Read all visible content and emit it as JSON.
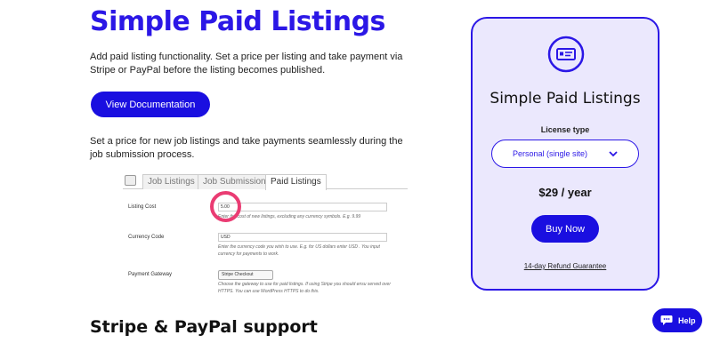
{
  "main": {
    "title": "Simple Paid Listings",
    "intro": "Add paid listing functionality. Set a price per listing and take payment via Stripe or PayPal before the listing becomes published.",
    "doc_button": "View Documentation",
    "description": "Set a price for new job listings and take payments seamlessly during the job submission process.",
    "section_title": "Stripe & PayPal support"
  },
  "screenshot": {
    "tabs": [
      "Job Listings",
      "Job Submission",
      "Paid Listings"
    ],
    "active_tab": "Paid Listings",
    "fields": [
      {
        "label": "Listing Cost",
        "value": "5.00",
        "help": "Enter the cost of new listings, excluding any currency symbols. E.g. 9.99"
      },
      {
        "label": "Currency Code",
        "value": "USD",
        "help": "Enter the currency code you wish to use. E.g. for US dollars enter USD . You input currency for payments to work."
      },
      {
        "label": "Payment Gateway",
        "value": "Stripe Checkout",
        "help": "Choose the gateway to use for paid listings. If using Stripe you should ensu served over HTTPS. You can use WordPress HTTPS to do this."
      }
    ]
  },
  "card": {
    "icon": "id-card-icon",
    "title": "Simple Paid Listings",
    "license_label": "License type",
    "license_value": "Personal (single site)",
    "price": "$29 / year",
    "buy_button": "Buy Now",
    "refund": "14-day Refund Guarantee"
  },
  "help": {
    "label": "Help",
    "icon": "chat-icon"
  },
  "colors": {
    "brand": "#2b17e6",
    "button": "#1a0fe0",
    "card_bg": "#ebe8fd",
    "highlight": "#ea3c73"
  }
}
